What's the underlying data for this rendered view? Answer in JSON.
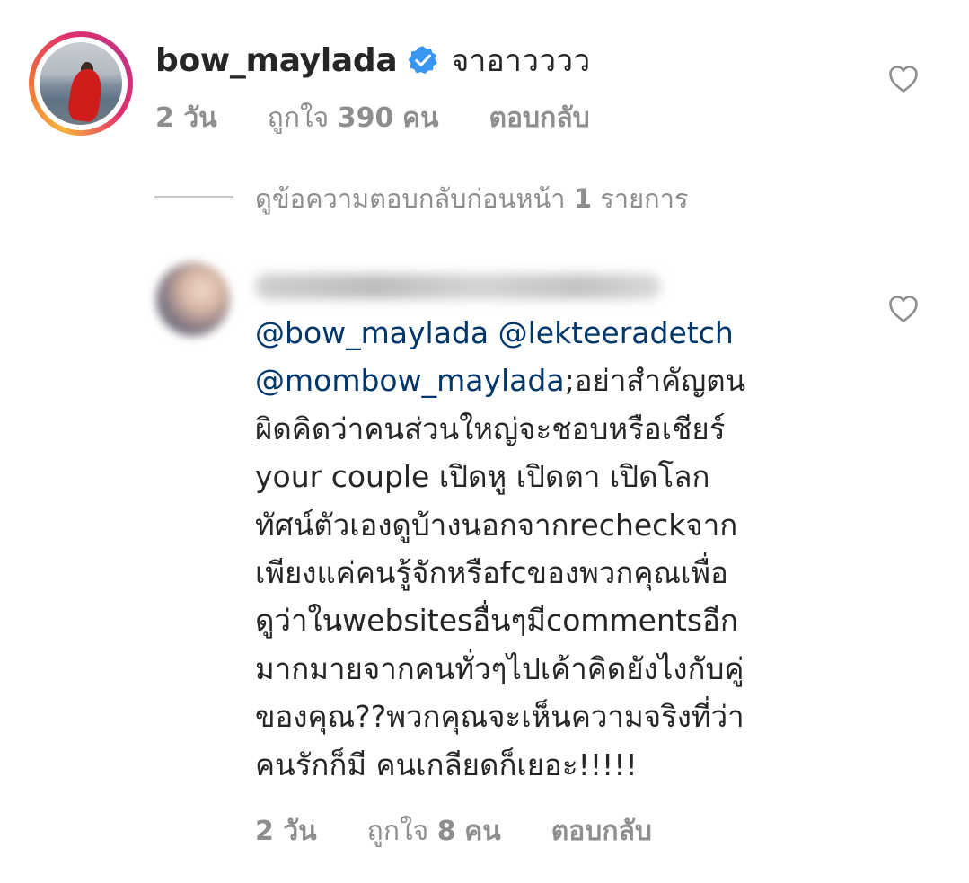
{
  "top_comment": {
    "username": "bow_maylada",
    "text": "จาอาวววว",
    "time": "2 วัน",
    "likes_prefix": "ถูกใจ",
    "likes_count": "390",
    "likes_suffix": "คน",
    "reply_label": "ตอบกลับ",
    "verified": true
  },
  "view_replies": {
    "text": "ดูข้อความตอบกลับก่อนหน้า",
    "count": "1",
    "suffix": "รายการ"
  },
  "reply": {
    "mention_1": "@bow_maylada",
    "mention_2": "@lekteeradetch",
    "mention_3": "@mombow_maylada",
    "line_2_rest": ";อย่าสำคัญตน",
    "lines": [
      "ผิดคิดว่าคนส่วนใหญ่จะชอบหรือเชียร์",
      "your couple เปิดหู เปิดตา เปิดโลก",
      "ทัศน์ตัวเองดูบ้างนอกจากrecheckจาก",
      "เพียงแค่คนรู้จักหรือfcของพวกคุณเพื่อ",
      "ดูว่าในwebsitesอื่นๆมีcommentsอีก",
      "มากมายจากคนทั่วๆไปเค้าคิดยังไงกับคู่",
      "ของคุณ??พวกคุณจะเห็นความจริงที่ว่า",
      "คนรักก็มี คนเกลียดก็เยอะ!!!!!"
    ],
    "time": "2 วัน",
    "likes_prefix": "ถูกใจ",
    "likes_count": "8",
    "likes_suffix": "คน",
    "reply_label": "ตอบกลับ"
  },
  "colors": {
    "text": "#262626",
    "secondary": "#8e8e8e",
    "mention": "#00376b",
    "verified": "#3897f0"
  },
  "icons": [
    "verified-badge-icon",
    "heart-icon"
  ]
}
